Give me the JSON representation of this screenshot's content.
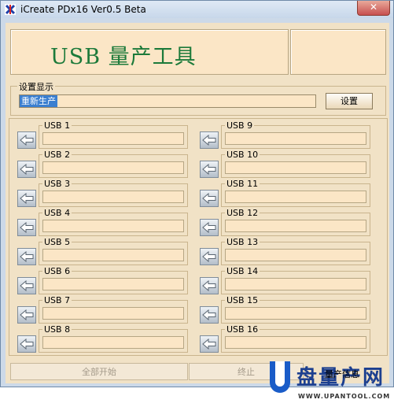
{
  "window": {
    "title": "iCreate PDx16 Ver0.5 Beta",
    "close_label": "✕"
  },
  "banner": {
    "title": "USB 量产工具"
  },
  "settings": {
    "legend": "设置显示",
    "value": "重新生产",
    "button": "设置"
  },
  "ports": [
    {
      "label": "USB 1"
    },
    {
      "label": "USB 2"
    },
    {
      "label": "USB 3"
    },
    {
      "label": "USB 4"
    },
    {
      "label": "USB 5"
    },
    {
      "label": "USB 6"
    },
    {
      "label": "USB 7"
    },
    {
      "label": "USB 8"
    },
    {
      "label": "USB 9"
    },
    {
      "label": "USB 10"
    },
    {
      "label": "USB 11"
    },
    {
      "label": "USB 12"
    },
    {
      "label": "USB 13"
    },
    {
      "label": "USB 14"
    },
    {
      "label": "USB 15"
    },
    {
      "label": "USB 16"
    }
  ],
  "bottom": {
    "start_all": "全部开始",
    "stop": "终止",
    "mp_info": "量产信息"
  },
  "watermark": {
    "text": "盘量产网",
    "url": "WWW.UPANTOOL.COM"
  }
}
